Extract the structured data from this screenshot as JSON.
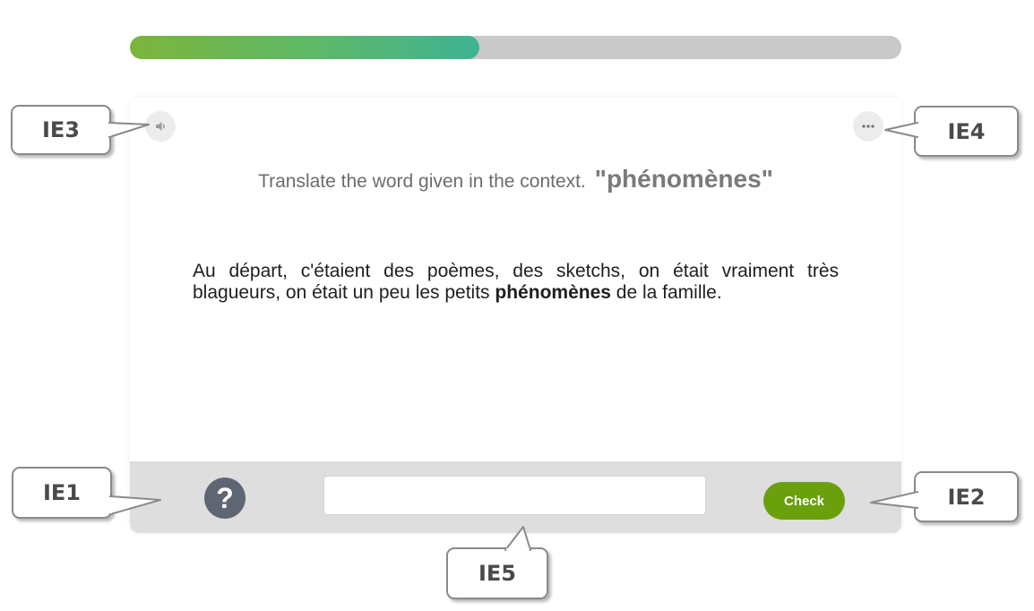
{
  "progress": {
    "fraction": 0.453
  },
  "card": {
    "speaker_icon": "speaker-icon",
    "more_icon": "more-options-icon",
    "instruction": "Translate the word given in the context.",
    "target_word": "\"phénomènes\"",
    "sentence": {
      "before": "Au départ, c'étaient des poèmes, des sketchs, on était vraiment très blagueurs, on était un peu les petits ",
      "highlight": "phénomènes",
      "after": " de la famille."
    },
    "footer": {
      "help_icon": "help-icon",
      "help_symbol": "?",
      "answer_value": "",
      "check_label": "Check"
    }
  },
  "colors": {
    "progress_start": "#7cb53a",
    "progress_end": "#3fb394",
    "check_button": "#6aa00c",
    "help_button": "#5f6673",
    "footer_bg": "#dedede"
  },
  "callouts": {
    "ie1": "IE1",
    "ie2": "IE2",
    "ie3": "IE3",
    "ie4": "IE4",
    "ie5": "IE5"
  }
}
